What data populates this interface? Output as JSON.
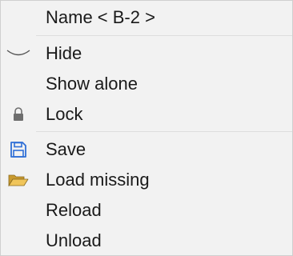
{
  "menu": {
    "header": "Name < B-2 >",
    "items": [
      {
        "label": "Hide",
        "icon": "closed-eye-icon"
      },
      {
        "label": "Show alone",
        "icon": null
      },
      {
        "label": "Lock",
        "icon": "lock-icon"
      },
      {
        "label": "Save",
        "icon": "floppy-disk-icon"
      },
      {
        "label": "Load missing",
        "icon": "open-folder-icon"
      },
      {
        "label": "Reload",
        "icon": null
      },
      {
        "label": "Unload",
        "icon": null
      }
    ]
  },
  "colors": {
    "menu_background": "#f2f2f2",
    "separator": "#dedede",
    "text": "#1a1a1a",
    "save_icon": "#2f6fd6",
    "folder_icon": "#d9a531"
  }
}
